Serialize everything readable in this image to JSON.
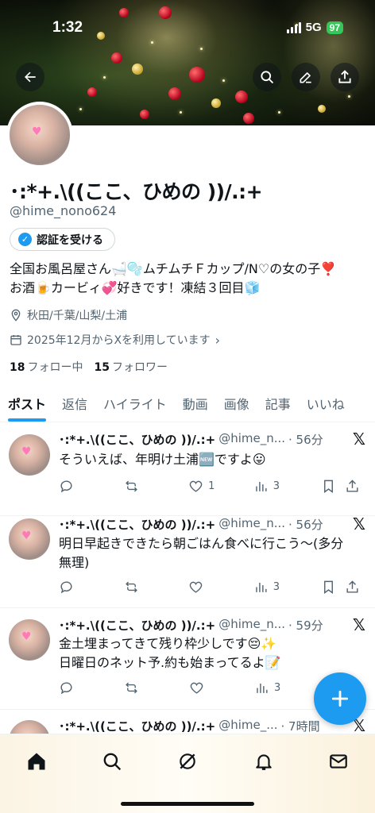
{
  "status_bar": {
    "time": "1:32",
    "network": "5G",
    "battery": "97"
  },
  "header": {
    "back_icon": "back-arrow-icon",
    "actions": [
      "search-icon",
      "edit-icon",
      "share-icon"
    ]
  },
  "profile": {
    "display_name": "･:*+.\\((ここ、ひめの ))/.:+",
    "handle": "@hime_nono624",
    "verify_button": "認証を受ける",
    "bio_line1": "全国お風呂屋さん🛁🫧ムチムチＦカップ/N♡の女の子❣️",
    "bio_line2": "お酒🍺カービィ💞好きです！凍結３回目🧊",
    "location": "秋田/千葉/山梨/土浦",
    "joined": "2025年12月からXを利用しています",
    "following_count": "18",
    "following_label": "フォロー中",
    "followers_count": "15",
    "followers_label": "フォロワー"
  },
  "tabs": [
    "ポスト",
    "返信",
    "ハイライト",
    "動画",
    "画像",
    "記事",
    "いいね"
  ],
  "posts": [
    {
      "name": "･:*+.\\((ここ、ひめの ))/.:+",
      "handle": "@hime_n...",
      "time": "· 56分",
      "text_line1": "そういえば、年明け土浦🆕ですよ😛",
      "text_line2": "",
      "likes": "1",
      "views": "3"
    },
    {
      "name": "･:*+.\\((ここ、ひめの ))/.:+",
      "handle": "@hime_n...",
      "time": "· 56分",
      "text_line1": "明日早起きできたら朝ごはん食べに行こう〜(多分",
      "text_line2": "無理)",
      "likes": "",
      "views": "3"
    },
    {
      "name": "･:*+.\\((ここ、ひめの ))/.:+",
      "handle": "@hime_n...",
      "time": "· 59分",
      "text_line1": "金土埋まってきて残り枠少しです😔✨",
      "text_line2": "日曜日のネット予.約も始まってるよ📝",
      "likes": "",
      "views": "3"
    },
    {
      "name": "･:*+.\\((ここ、ひめの ))/.:+",
      "handle": "@hime_...",
      "time": "· 7時間"
    }
  ],
  "colors": {
    "accent": "#1d9bf0",
    "text": "#0f1419",
    "muted": "#536471"
  },
  "bottom_nav": [
    "home-icon",
    "search-icon",
    "grok-icon",
    "notifications-icon",
    "messages-icon"
  ],
  "fab_icon": "plus-icon"
}
